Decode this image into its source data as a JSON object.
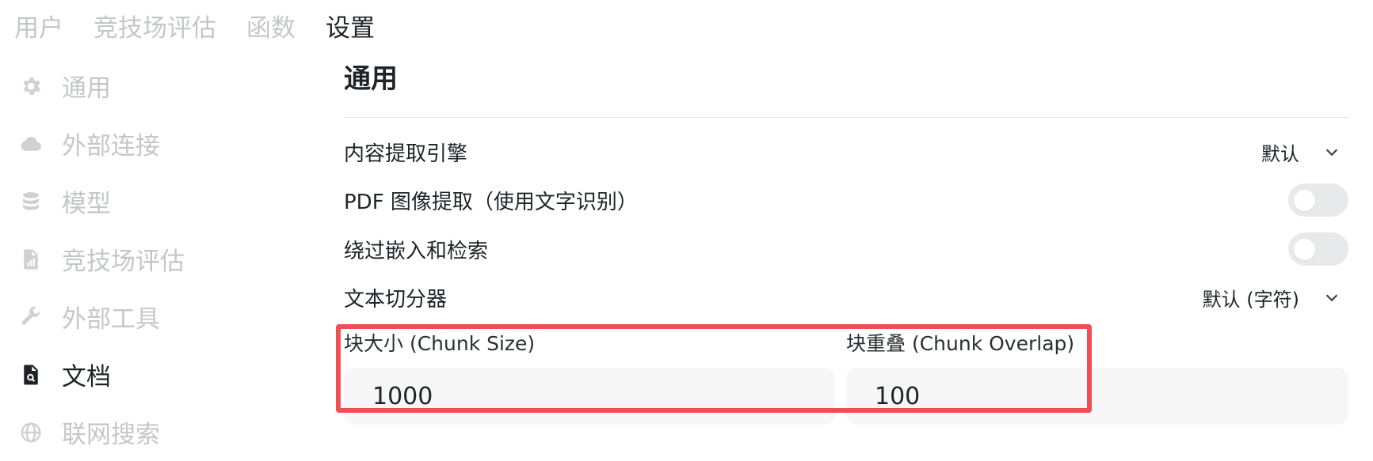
{
  "tabs": {
    "items": [
      {
        "label": "用户"
      },
      {
        "label": "竞技场评估"
      },
      {
        "label": "函数"
      },
      {
        "label": "设置"
      }
    ],
    "active_index": 3
  },
  "sidebar": {
    "items": [
      {
        "label": "通用",
        "icon": "gear-icon"
      },
      {
        "label": "外部连接",
        "icon": "cloud-icon"
      },
      {
        "label": "模型",
        "icon": "database-icon"
      },
      {
        "label": "竞技场评估",
        "icon": "document-chart-icon"
      },
      {
        "label": "外部工具",
        "icon": "wrench-icon"
      },
      {
        "label": "文档",
        "icon": "document-search-icon"
      },
      {
        "label": "联网搜索",
        "icon": "globe-icon"
      }
    ],
    "active_index": 5
  },
  "main": {
    "title": "通用",
    "content_engine": {
      "label": "内容提取引擎",
      "value": "默认"
    },
    "pdf_ocr": {
      "label": "PDF 图像提取（使用文字识别）",
      "enabled": false
    },
    "bypass_embedding": {
      "label": "绕过嵌入和检索",
      "enabled": false
    },
    "text_splitter": {
      "label": "文本切分器",
      "value": "默认 (字符)"
    },
    "chunk_size": {
      "label": "块大小 (Chunk Size)",
      "value": "1000"
    },
    "chunk_overlap": {
      "label": "块重叠 (Chunk Overlap)",
      "value": "100"
    }
  },
  "colors": {
    "highlight": "#f04e55",
    "inactive_text": "#c4c6c9",
    "active_text": "#1f2328"
  }
}
